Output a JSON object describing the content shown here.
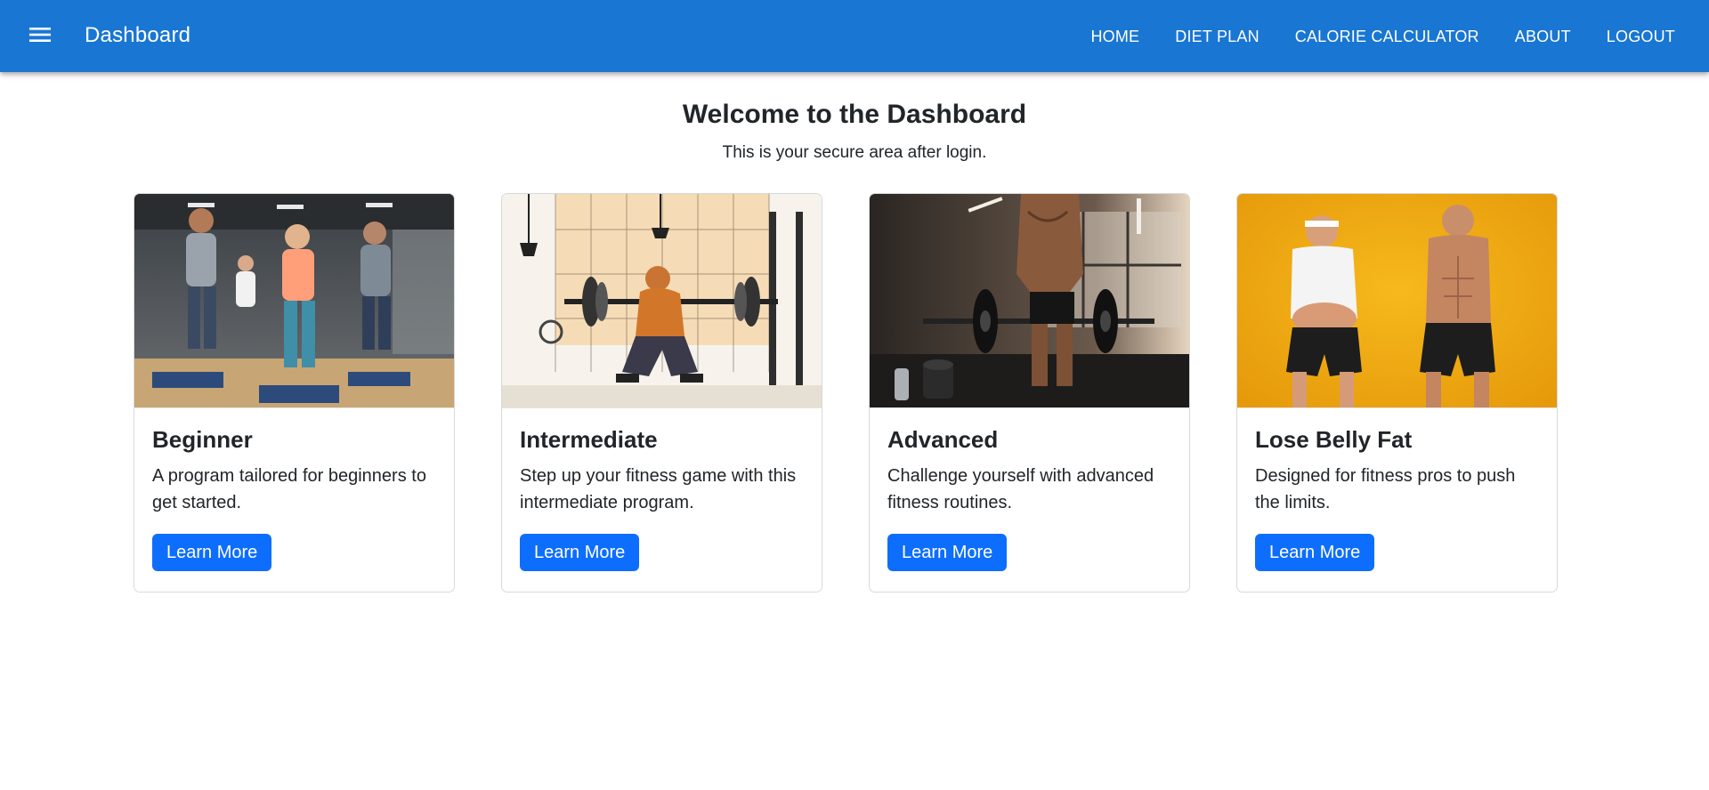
{
  "appbar": {
    "title": "Dashboard",
    "menu_icon": "menu-icon",
    "color": "#1976d2",
    "nav": [
      "HOME",
      "DIET PLAN",
      "CALORIE CALCULATOR",
      "ABOUT",
      "LOGOUT"
    ]
  },
  "main": {
    "heading": "Welcome to the Dashboard",
    "subtitle": "This is your secure area after login."
  },
  "cards": [
    {
      "title": "Beginner",
      "text": "A program tailored for beginners to get started.",
      "button": "Learn More",
      "image": "group-step-workout-photo"
    },
    {
      "title": "Intermediate",
      "text": "Step up your fitness game with this intermediate program.",
      "button": "Learn More",
      "image": "barbell-squat-illustration"
    },
    {
      "title": "Advanced",
      "text": "Challenge yourself with advanced fitness routines.",
      "button": "Learn More",
      "image": "muscular-athlete-gym-photo"
    },
    {
      "title": "Lose Belly Fat",
      "text": "Designed for fitness pros to push the limits.",
      "button": "Learn More",
      "image": "before-after-belly-fat-photo"
    }
  ],
  "accent": "#0d6efd"
}
